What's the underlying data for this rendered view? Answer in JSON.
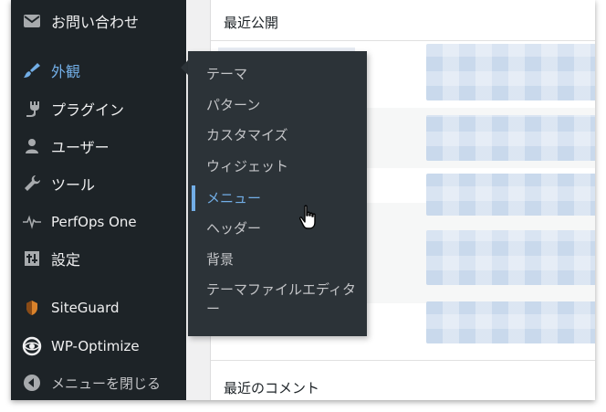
{
  "sidebar": {
    "items": [
      {
        "label": "お問い合わせ",
        "icon": "envelope-icon"
      },
      {
        "label": "外観",
        "icon": "paintbrush-icon",
        "active": true
      },
      {
        "label": "プラグイン",
        "icon": "plugin-icon"
      },
      {
        "label": "ユーザー",
        "icon": "user-icon"
      },
      {
        "label": "ツール",
        "icon": "wrench-icon"
      },
      {
        "label": "PerfOps One",
        "icon": "pulse-icon"
      },
      {
        "label": "設定",
        "icon": "settings-icon"
      },
      {
        "label": "SiteGuard",
        "icon": "shield-icon"
      },
      {
        "label": "WP-Optimize",
        "icon": "optimize-icon"
      }
    ],
    "collapse_label": "メニューを閉じる"
  },
  "flyout": {
    "items": [
      {
        "label": "テーマ"
      },
      {
        "label": "パターン"
      },
      {
        "label": "カスタマイズ"
      },
      {
        "label": "ウィジェット"
      },
      {
        "label": "メニュー",
        "current": true
      },
      {
        "label": "ヘッダー"
      },
      {
        "label": "背景"
      },
      {
        "label": "テーマファイルエディター"
      }
    ]
  },
  "main": {
    "recent_published_heading": "最近公開",
    "recent_comments_heading": "最近のコメント"
  },
  "colors": {
    "sidebar_bg": "#1d2327",
    "flyout_bg": "#2c3338",
    "accent": "#72aee6",
    "text": "#f0f0f1"
  }
}
